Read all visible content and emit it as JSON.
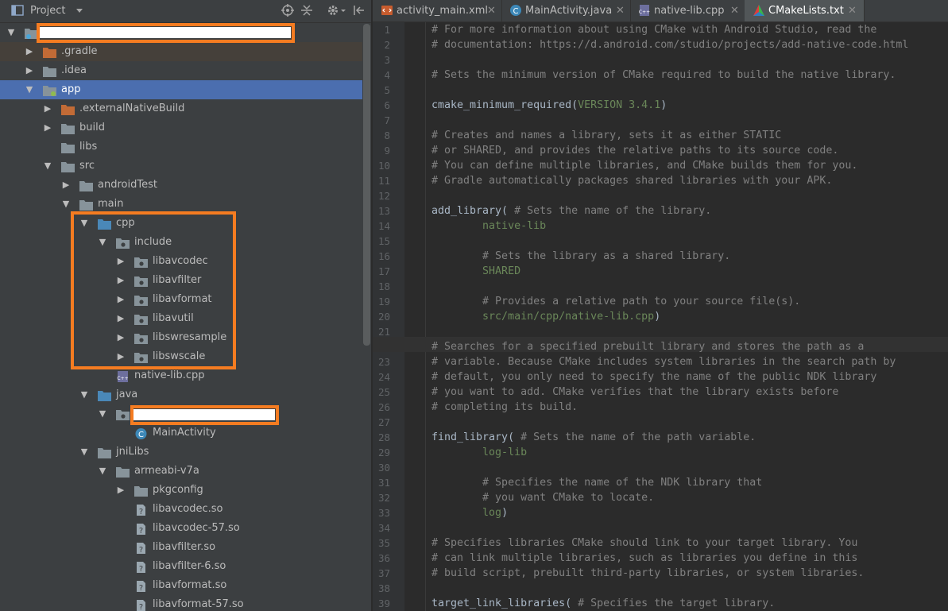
{
  "project_panel": {
    "title": "Project",
    "tree": [
      {
        "label": "",
        "indent": 0,
        "expanded": true,
        "icon": "module",
        "redacted": true
      },
      {
        "label": ".gradle",
        "indent": 1,
        "expanded": false,
        "icon": "folder-orange",
        "excluded": true
      },
      {
        "label": ".idea",
        "indent": 1,
        "expanded": false,
        "icon": "folder"
      },
      {
        "label": "app",
        "indent": 1,
        "expanded": true,
        "icon": "module-folder",
        "selected": true
      },
      {
        "label": ".externalNativeBuild",
        "indent": 2,
        "expanded": false,
        "icon": "folder-orange"
      },
      {
        "label": "build",
        "indent": 2,
        "expanded": false,
        "icon": "folder"
      },
      {
        "label": "libs",
        "indent": 2,
        "icon": "folder"
      },
      {
        "label": "src",
        "indent": 2,
        "expanded": true,
        "icon": "folder"
      },
      {
        "label": "androidTest",
        "indent": 3,
        "expanded": false,
        "icon": "folder"
      },
      {
        "label": "main",
        "indent": 3,
        "expanded": true,
        "icon": "folder"
      },
      {
        "label": "cpp",
        "indent": 4,
        "expanded": true,
        "icon": "folder-blue"
      },
      {
        "label": "include",
        "indent": 5,
        "expanded": true,
        "icon": "package"
      },
      {
        "label": "libavcodec",
        "indent": 6,
        "expanded": false,
        "icon": "package"
      },
      {
        "label": "libavfilter",
        "indent": 6,
        "expanded": false,
        "icon": "package"
      },
      {
        "label": "libavformat",
        "indent": 6,
        "expanded": false,
        "icon": "package"
      },
      {
        "label": "libavutil",
        "indent": 6,
        "expanded": false,
        "icon": "package"
      },
      {
        "label": "libswresample",
        "indent": 6,
        "expanded": false,
        "icon": "package"
      },
      {
        "label": "libswscale",
        "indent": 6,
        "expanded": false,
        "icon": "package"
      },
      {
        "label": "native-lib.cpp",
        "indent": 5,
        "icon": "cpp-file"
      },
      {
        "label": "java",
        "indent": 4,
        "expanded": true,
        "icon": "folder-blue"
      },
      {
        "label": "",
        "indent": 5,
        "expanded": true,
        "icon": "package",
        "redacted": true
      },
      {
        "label": "MainActivity",
        "indent": 6,
        "icon": "class"
      },
      {
        "label": "jniLibs",
        "indent": 4,
        "expanded": true,
        "icon": "folder"
      },
      {
        "label": "armeabi-v7a",
        "indent": 5,
        "expanded": true,
        "icon": "folder"
      },
      {
        "label": "pkgconfig",
        "indent": 6,
        "expanded": false,
        "icon": "folder"
      },
      {
        "label": "libavcodec.so",
        "indent": 6,
        "icon": "unknown-file"
      },
      {
        "label": "libavcodec-57.so",
        "indent": 6,
        "icon": "unknown-file"
      },
      {
        "label": "libavfilter.so",
        "indent": 6,
        "icon": "unknown-file"
      },
      {
        "label": "libavfilter-6.so",
        "indent": 6,
        "icon": "unknown-file"
      },
      {
        "label": "libavformat.so",
        "indent": 6,
        "icon": "unknown-file"
      },
      {
        "label": "libavformat-57.so",
        "indent": 6,
        "icon": "unknown-file"
      }
    ]
  },
  "editor": {
    "tabs": [
      {
        "label": "activity_main.xml",
        "icon": "xml-file-icon",
        "active": false
      },
      {
        "label": "MainActivity.java",
        "icon": "class-icon",
        "active": false
      },
      {
        "label": "native-lib.cpp",
        "icon": "cpp-file-icon",
        "active": false
      },
      {
        "label": "CMakeLists.txt",
        "icon": "cmake-icon",
        "active": true
      }
    ],
    "lines": [
      {
        "n": "1",
        "t": "# For more information about using CMake with Android Studio, read the",
        "k": "comment"
      },
      {
        "n": "2",
        "t": "# documentation: https://d.android.com/studio/projects/add-native-code.html",
        "k": "comment"
      },
      {
        "n": "3",
        "t": "",
        "k": "plain"
      },
      {
        "n": "4",
        "t": "# Sets the minimum version of CMake required to build the native library.",
        "k": "comment"
      },
      {
        "n": "5",
        "t": "",
        "k": "plain"
      },
      {
        "n": "6",
        "t": "cmake_minimum_required(",
        "k": "call",
        "arg": "VERSION 3.4.1",
        "tail": ")"
      },
      {
        "n": "7",
        "t": "",
        "k": "plain"
      },
      {
        "n": "8",
        "t": "# Creates and names a library, sets it as either STATIC",
        "k": "comment"
      },
      {
        "n": "9",
        "t": "# or SHARED, and provides the relative paths to its source code.",
        "k": "comment"
      },
      {
        "n": "10",
        "t": "# You can define multiple libraries, and CMake builds them for you.",
        "k": "comment"
      },
      {
        "n": "11",
        "t": "# Gradle automatically packages shared libraries with your APK.",
        "k": "comment"
      },
      {
        "n": "12",
        "t": "",
        "k": "plain"
      },
      {
        "n": "13",
        "t": "add_library(",
        "k": "call",
        "comment": " # Sets the name of the library."
      },
      {
        "n": "14",
        "t": "        native-lib",
        "k": "arg"
      },
      {
        "n": "15",
        "t": "",
        "k": "plain"
      },
      {
        "n": "16",
        "t": "        # Sets the library as a shared library.",
        "k": "comment"
      },
      {
        "n": "17",
        "t": "        SHARED",
        "k": "arg"
      },
      {
        "n": "18",
        "t": "",
        "k": "plain"
      },
      {
        "n": "19",
        "t": "        # Provides a relative path to your source file(s).",
        "k": "comment"
      },
      {
        "n": "20",
        "t": "        src/main/cpp/native-lib.cpp",
        "k": "arg",
        "tail": ")"
      },
      {
        "n": "21",
        "t": "",
        "k": "plain"
      },
      {
        "n": "22",
        "t": "# Searches for a specified prebuilt library and stores the path as a",
        "k": "comment"
      },
      {
        "n": "23",
        "t": "# variable. Because CMake includes system libraries in the search path by",
        "k": "comment"
      },
      {
        "n": "24",
        "t": "# default, you only need to specify the name of the public NDK library",
        "k": "comment"
      },
      {
        "n": "25",
        "t": "# you want to add. CMake verifies that the library exists before",
        "k": "comment"
      },
      {
        "n": "26",
        "t": "# completing its build.",
        "k": "comment"
      },
      {
        "n": "27",
        "t": "",
        "k": "plain"
      },
      {
        "n": "28",
        "t": "find_library(",
        "k": "call",
        "comment": " # Sets the name of the path variable."
      },
      {
        "n": "29",
        "t": "        log-lib",
        "k": "arg"
      },
      {
        "n": "30",
        "t": "",
        "k": "plain"
      },
      {
        "n": "31",
        "t": "        # Specifies the name of the NDK library that",
        "k": "comment"
      },
      {
        "n": "32",
        "t": "        # you want CMake to locate.",
        "k": "comment"
      },
      {
        "n": "33",
        "t": "        log",
        "k": "arg",
        "tail": ")"
      },
      {
        "n": "34",
        "t": "",
        "k": "plain"
      },
      {
        "n": "35",
        "t": "# Specifies libraries CMake should link to your target library. You",
        "k": "comment"
      },
      {
        "n": "36",
        "t": "# can link multiple libraries, such as libraries you define in this",
        "k": "comment"
      },
      {
        "n": "37",
        "t": "# build script, prebuilt third-party libraries, or system libraries.",
        "k": "comment"
      },
      {
        "n": "38",
        "t": "",
        "k": "plain"
      },
      {
        "n": "39",
        "t": "target_link_libraries(",
        "k": "call",
        "comment": " # Specifies the target library."
      }
    ]
  },
  "colors": {
    "selection": "#4b6eaf",
    "highlight_box": "#f57c21",
    "comment": "#808080",
    "argument": "#6a8759"
  }
}
